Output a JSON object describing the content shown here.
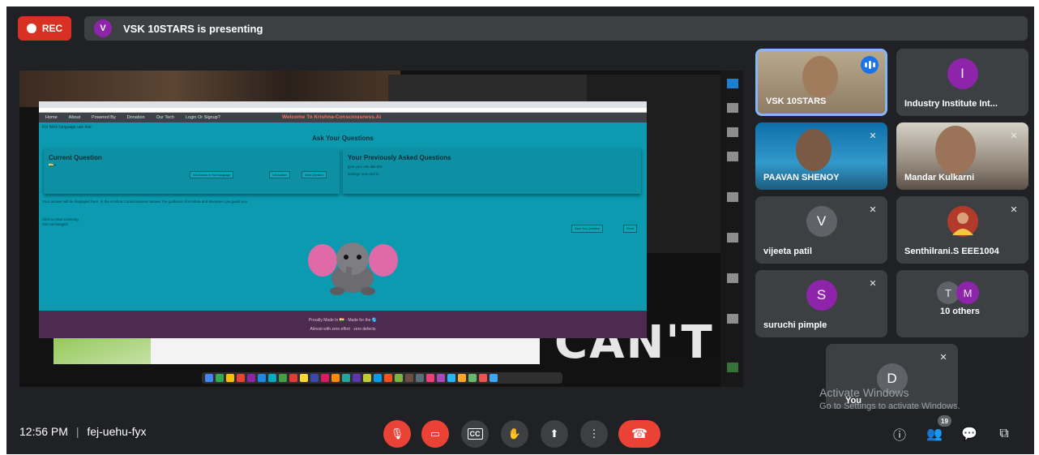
{
  "recording": {
    "label": "REC"
  },
  "presenter_bar": {
    "initial": "V",
    "text": "VSK 10STARS is presenting"
  },
  "shared_screen": {
    "site": {
      "nav": [
        "Home",
        "About",
        "Powered By",
        "Donation",
        "Our Tech",
        "Login Or Signup?"
      ],
      "welcome": "Welcome To Krishna-Consciousness.Ai",
      "language_note": "For fetch language use this:",
      "ask_title": "Ask Your Questions",
      "current_question_title": "Current Question",
      "current_question_flag": "🇮🇳 A",
      "buttons": [
        "Get Answer in Your Language",
        "Get Answer",
        "Save Question"
      ],
      "previous_title": "Your Previously Asked Questions",
      "previous_items": [
        "give your site like this",
        "arrange new and to"
      ],
      "answer_note": "Your answer will be displayed here. In the Krishna Consciousness answer the guidance of Krishna and devotees can guide you.",
      "listen_lines": [
        "Click to Start Listening",
        "Get Unchanged"
      ],
      "right_buttons": [
        "Save Your Question",
        "Reset"
      ],
      "footer_lines": [
        "Proudly Made In 🇮🇳 · Made for the 🌎",
        "Almost with zero effort · zero defects"
      ]
    },
    "background_text": "CAN'T"
  },
  "participants": [
    {
      "name": "VSK 10STARS",
      "type": "video",
      "speaking": true
    },
    {
      "name": "Industry Institute Int...",
      "type": "avatar",
      "initial": "I",
      "color": "#8e24aa"
    },
    {
      "name": "PAAVAN SHENOY",
      "type": "video",
      "muted": true
    },
    {
      "name": "Mandar Kulkarni",
      "type": "video",
      "muted": true
    },
    {
      "name": "vijeeta patil",
      "type": "avatar",
      "initial": "V",
      "color": "#5f6368",
      "muted": true
    },
    {
      "name": "Senthilrani.S EEE1004",
      "type": "photo-avatar",
      "muted": true
    },
    {
      "name": "suruchi pimple",
      "type": "avatar",
      "initial": "S",
      "color": "#8e24aa",
      "muted": true
    },
    {
      "name": "10 others",
      "type": "group",
      "initials": [
        "T",
        "M"
      ]
    },
    {
      "name": "You",
      "type": "avatar",
      "initial": "D",
      "color": "#5f6368",
      "muted": true
    }
  ],
  "watermark": {
    "title": "Activate Windows",
    "subtitle": "Go to Settings to activate Windows."
  },
  "bottom_bar": {
    "time": "12:56 PM",
    "separator": "|",
    "meeting_code": "fej-uehu-fyx",
    "people_count": "19"
  },
  "icons": {
    "mic": "mic-off-icon",
    "camera": "camera-off-icon",
    "captions": "captions-icon",
    "hand": "raise-hand-icon",
    "present": "present-icon",
    "more": "more-options-icon",
    "hangup": "hang-up-icon",
    "info": "info-icon",
    "people": "people-icon",
    "chat": "chat-icon",
    "activities": "activities-icon"
  }
}
